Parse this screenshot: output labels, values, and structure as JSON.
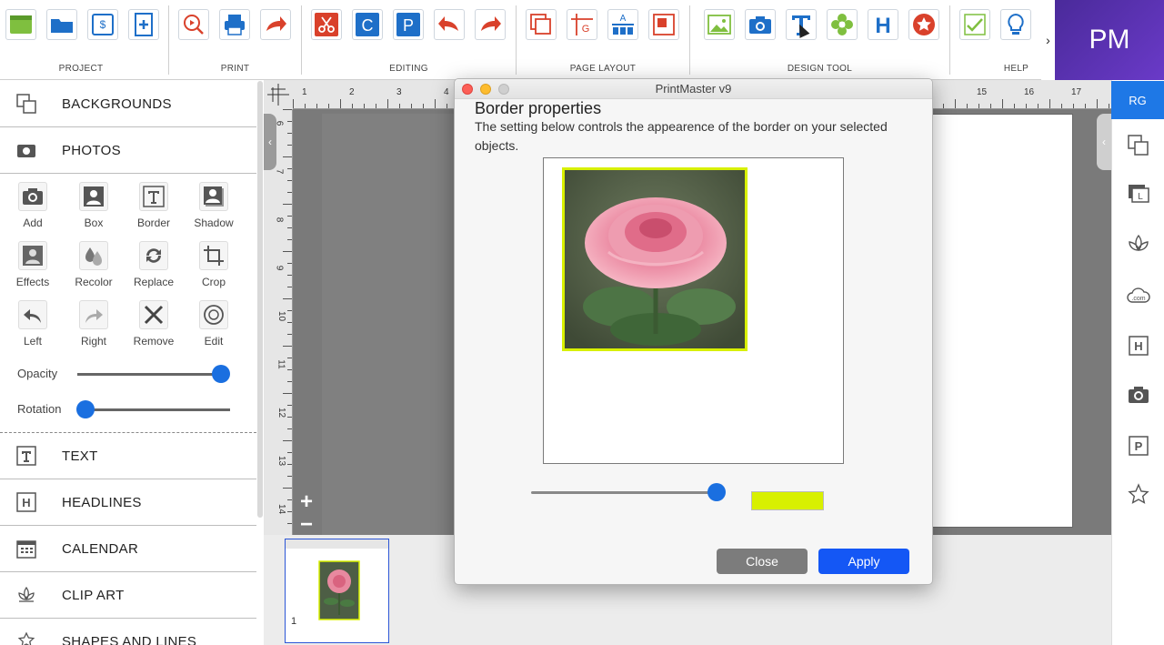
{
  "app": {
    "window_title": "PrintMaster v9",
    "brand": "PM",
    "user_initials": "RG",
    "more_arrow": "›"
  },
  "toolbar": {
    "groups": [
      {
        "label": "PROJECT"
      },
      {
        "label": "PRINT"
      },
      {
        "label": "EDITING"
      },
      {
        "label": "PAGE LAYOUT"
      },
      {
        "label": "DESIGN TOOL"
      },
      {
        "label": "HELP"
      }
    ]
  },
  "left_panel": {
    "sections": {
      "backgrounds": "BACKGROUNDS",
      "photos": "PHOTOS",
      "text": "TEXT",
      "headlines": "HEADLINES",
      "calendar": "CALENDAR",
      "clip_art": "CLIP ART",
      "shapes": "SHAPES AND LINES"
    },
    "photo_tools": [
      "Add",
      "Box",
      "Border",
      "Shadow",
      "Effects",
      "Recolor",
      "Replace",
      "Crop",
      "Left",
      "Right",
      "Remove",
      "Edit"
    ],
    "opacity_label": "Opacity",
    "rotation_label": "Rotation",
    "opacity_value": 1.0,
    "rotation_value": 0.0
  },
  "canvas": {
    "ruler_top": [
      "1",
      "2",
      "3",
      "4",
      "15",
      "16",
      "17"
    ],
    "ruler_left": [
      "6",
      "7",
      "8",
      "9",
      "10",
      "11",
      "12",
      "13",
      "14"
    ],
    "zoom_in": "+",
    "zoom_out": "−",
    "page_number": "1"
  },
  "dialog": {
    "title": "PrintMaster v9",
    "heading": "Border properties",
    "description": "The setting below controls the appearence of the border on your selected objects.",
    "border_color": "#d8f000",
    "border_width_value": 1.0,
    "close_label": "Close",
    "apply_label": "Apply"
  },
  "colors": {
    "accent_blue": "#1457f5",
    "brand_purple": "#5a32b4",
    "icon_red": "#d9412b",
    "icon_blue": "#1e6fc8",
    "icon_green": "#7fbf3f"
  }
}
